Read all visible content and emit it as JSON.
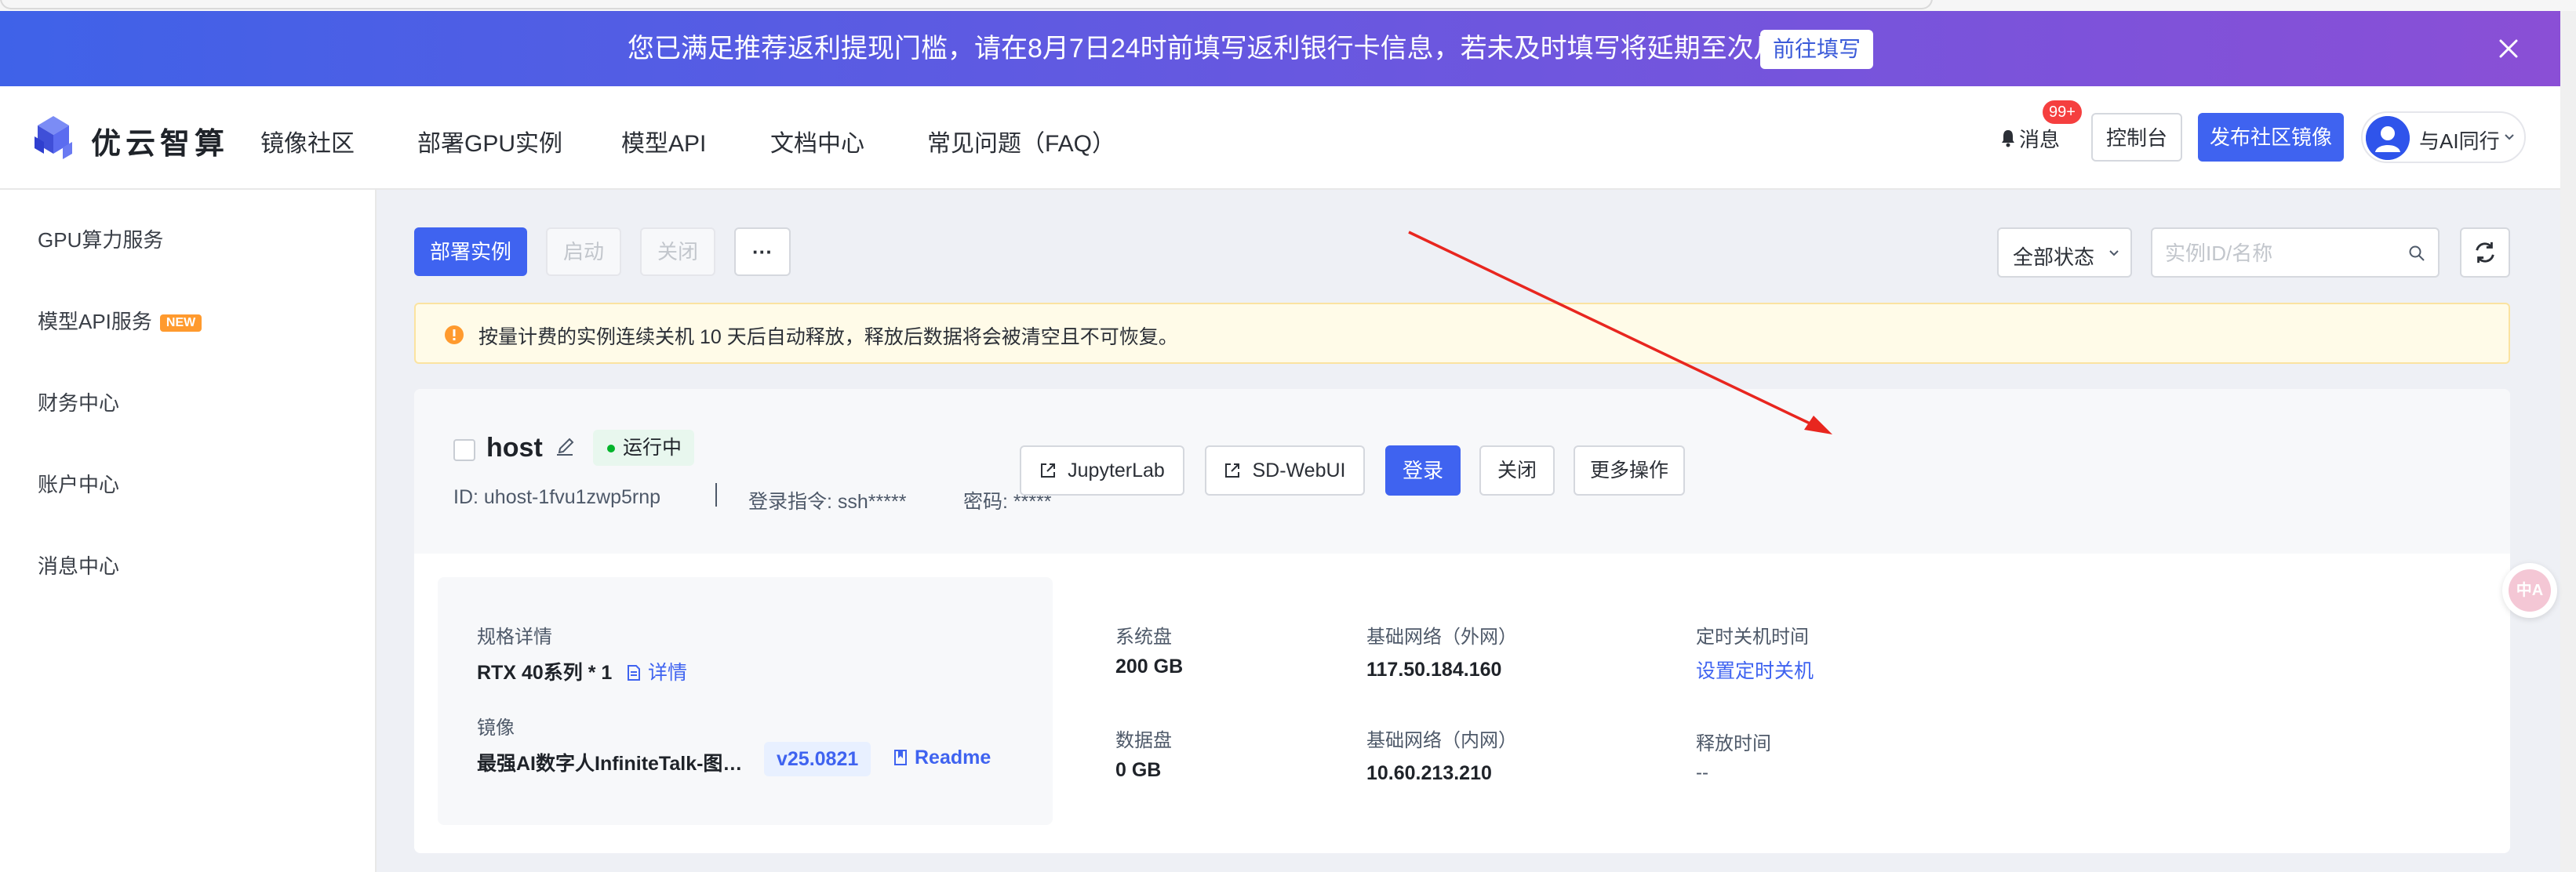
{
  "banner": {
    "text": "您已满足推荐返利提现门槛，请在8月7日24时前填写返利银行卡信息，若未及时填写将延期至次月！",
    "action_label": "前往填写"
  },
  "header": {
    "brand": "优云智算",
    "nav": [
      "镜像社区",
      "部署GPU实例",
      "模型API",
      "文档中心",
      "常见问题（FAQ）"
    ],
    "messages_label": "消息",
    "messages_badge": "99+",
    "console_label": "控制台",
    "publish_label": "发布社区镜像",
    "user_name": "与AI同行"
  },
  "sidebar": {
    "items": [
      "GPU算力服务",
      "模型API服务",
      "财务中心",
      "账户中心",
      "消息中心"
    ],
    "new_badge": "NEW"
  },
  "toolbar": {
    "deploy_label": "部署实例",
    "start_label": "启动",
    "stop_label": "关闭",
    "more_label": "···",
    "status_filter": "全部状态",
    "search_placeholder": "实例ID/名称"
  },
  "notice": {
    "text": "按量计费的实例连续关机 10 天后自动释放，释放后数据将会被清空且不可恢复。"
  },
  "instance": {
    "name": "host",
    "status": "运行中",
    "id": "ID: uhost-1fvu1zwp5rnp",
    "login_cmd": "登录指令: ssh*****",
    "password": "密码: *****",
    "actions": {
      "jupyter": "JupyterLab",
      "sdwebui": "SD-WebUI",
      "login": "登录",
      "close": "关闭",
      "more": "更多操作"
    },
    "spec_label": "规格详情",
    "spec_value": "RTX 40系列 * 1",
    "spec_detail_link": "详情",
    "image_label": "镜像",
    "image_value": "最强AI数字人InfiniteTalk-图…",
    "image_version": "v25.0821",
    "readme_link": "Readme",
    "system_disk_label": "系统盘",
    "system_disk_value": "200 GB",
    "data_disk_label": "数据盘",
    "data_disk_value": "0 GB",
    "net_ext_label": "基础网络（外网）",
    "net_ext_value": "117.50.184.160",
    "net_int_label": "基础网络（内网）",
    "net_int_value": "10.60.213.210",
    "timer_label": "定时关机时间",
    "timer_link": "设置定时关机",
    "release_label": "释放时间",
    "release_value": "--"
  },
  "floating_widget": "中A",
  "colors": {
    "primary": "#3f63f0",
    "banner_start": "#3f62e8",
    "banner_end": "#8a4fd6",
    "running_dot": "#00b42a",
    "annotation_arrow": "#e8261f"
  }
}
